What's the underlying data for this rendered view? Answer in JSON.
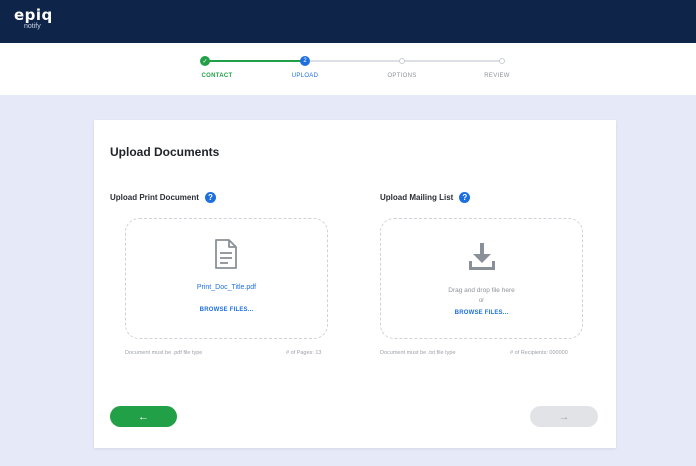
{
  "header": {
    "logo_main": "epiq",
    "logo_sub": "notify"
  },
  "stepper": {
    "steps": [
      {
        "label": "CONTACT",
        "status": "complete",
        "marker": "✓"
      },
      {
        "label": "UPLOAD",
        "status": "active",
        "marker": "2"
      },
      {
        "label": "OPTIONS",
        "status": "pending",
        "marker": "3"
      },
      {
        "label": "REVIEW",
        "status": "pending",
        "marker": "4"
      }
    ]
  },
  "main": {
    "title": "Upload Documents",
    "print_document": {
      "label": "Upload Print Document",
      "help_icon": "?",
      "icon": "document-icon",
      "filename": "Print_Doc_Title.pdf",
      "browse_label": "BROWSE FILES...",
      "footer_left": "Document must be .pdf file type",
      "footer_right": "# of Pages: 13"
    },
    "mailing_list": {
      "label": "Upload Mailing List",
      "help_icon": "?",
      "icon": "download-icon",
      "drag_text": "Drag and drop file here",
      "or_text": "or",
      "browse_label": "BROWSE FILES...",
      "footer_left": "Document must be .txt file type",
      "footer_right": "# of Recipients: 000000"
    },
    "back_button": "←",
    "next_button": "→"
  },
  "colors": {
    "nav_bg": "#0f2449",
    "success": "#22a047",
    "primary": "#1d6fe0",
    "page_bg": "#e6eaf8",
    "disabled": "#e2e3e6"
  }
}
